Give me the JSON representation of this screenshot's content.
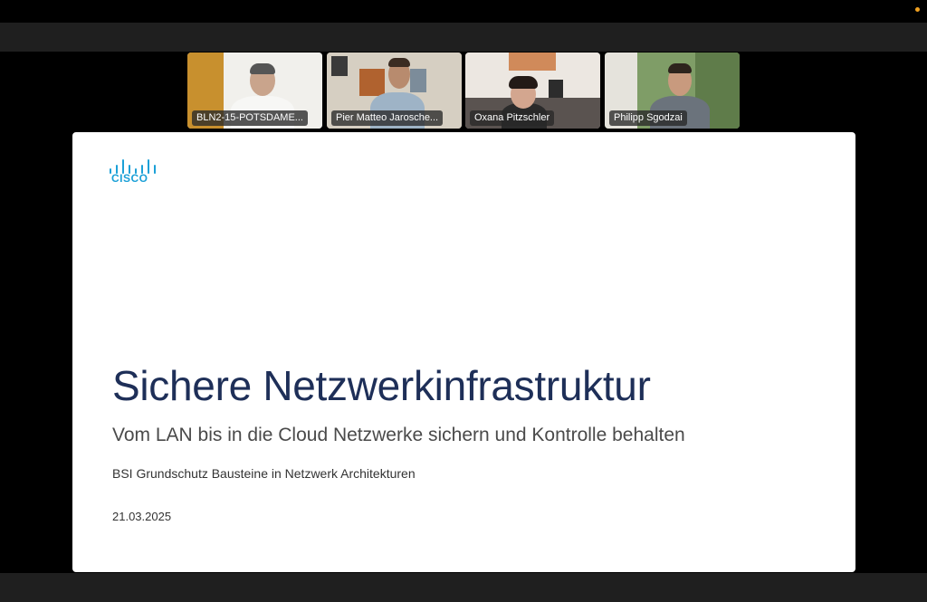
{
  "participants": [
    {
      "name": "BLN2-15-POTSDAME..."
    },
    {
      "name": "Pier Matteo Jarosche..."
    },
    {
      "name": "Oxana Pitzschler"
    },
    {
      "name": "Philipp Sgodzai"
    }
  ],
  "slide": {
    "logo_text": "CISCO",
    "title": "Sichere Netzwerkinfrastruktur",
    "subtitle": "Vom LAN bis in die Cloud Netzwerke sichern und Kontrolle behalten",
    "subline": "BSI Grundschutz Bausteine in Netzwerk Architekturen",
    "date": "21.03.2025"
  },
  "colors": {
    "brand": "#1ba0d7",
    "title": "#1e2f58",
    "status_dot": "#f0a020"
  }
}
